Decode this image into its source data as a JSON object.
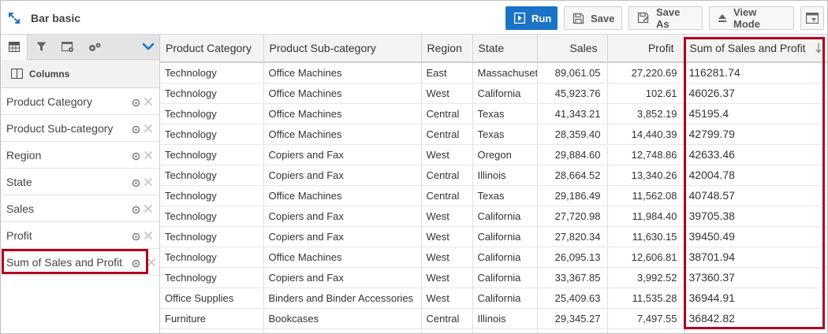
{
  "app": {
    "title": "Bar basic"
  },
  "toolbar": {
    "run_label": "Run",
    "save_label": "Save",
    "save_as_label": "Save As",
    "view_mode_label": "View Mode"
  },
  "sidebar": {
    "section_label": "Columns",
    "items": [
      {
        "label": "Product Category"
      },
      {
        "label": "Product Sub-category"
      },
      {
        "label": "Region"
      },
      {
        "label": "State"
      },
      {
        "label": "Sales"
      },
      {
        "label": "Profit"
      },
      {
        "label": "Sum of Sales and Profit"
      }
    ]
  },
  "table": {
    "columns": [
      "Product Category",
      "Product Sub-category",
      "Region",
      "State",
      "Sales",
      "Profit",
      "Sum of Sales and Profit"
    ],
    "rows": [
      [
        "Technology",
        "Office Machines",
        "East",
        "Massachusetts",
        "89,061.05",
        "27,220.69",
        "116281.74"
      ],
      [
        "Technology",
        "Office Machines",
        "West",
        "California",
        "45,923.76",
        "102.61",
        "46026.37"
      ],
      [
        "Technology",
        "Office Machines",
        "Central",
        "Texas",
        "41,343.21",
        "3,852.19",
        "45195.4"
      ],
      [
        "Technology",
        "Office Machines",
        "Central",
        "Texas",
        "28,359.40",
        "14,440.39",
        "42799.79"
      ],
      [
        "Technology",
        "Copiers and Fax",
        "West",
        "Oregon",
        "29,884.60",
        "12,748.86",
        "42633.46"
      ],
      [
        "Technology",
        "Copiers and Fax",
        "Central",
        "Illinois",
        "28,664.52",
        "13,340.26",
        "42004.78"
      ],
      [
        "Technology",
        "Office Machines",
        "Central",
        "Texas",
        "29,186.49",
        "11,562.08",
        "40748.57"
      ],
      [
        "Technology",
        "Copiers and Fax",
        "West",
        "California",
        "27,720.98",
        "11,984.40",
        "39705.38"
      ],
      [
        "Technology",
        "Copiers and Fax",
        "West",
        "California",
        "27,820.34",
        "11,630.15",
        "39450.49"
      ],
      [
        "Technology",
        "Office Machines",
        "West",
        "California",
        "26,095.13",
        "12,606.81",
        "38701.94"
      ],
      [
        "Technology",
        "Copiers and Fax",
        "West",
        "California",
        "33,367.85",
        "3,992.52",
        "37360.37"
      ],
      [
        "Office Supplies",
        "Binders and Binder Accessories",
        "West",
        "California",
        "25,409.63",
        "11,535.28",
        "36944.91"
      ],
      [
        "Furniture",
        "Bookcases",
        "Central",
        "Illinois",
        "29,345.27",
        "7,497.55",
        "36842.82"
      ],
      [
        "",
        "",
        "",
        "",
        "",
        "",
        ""
      ]
    ]
  },
  "colors": {
    "run_button": "#1a73c7",
    "highlight": "#b00020",
    "accent_chevron": "#1a73c7"
  }
}
